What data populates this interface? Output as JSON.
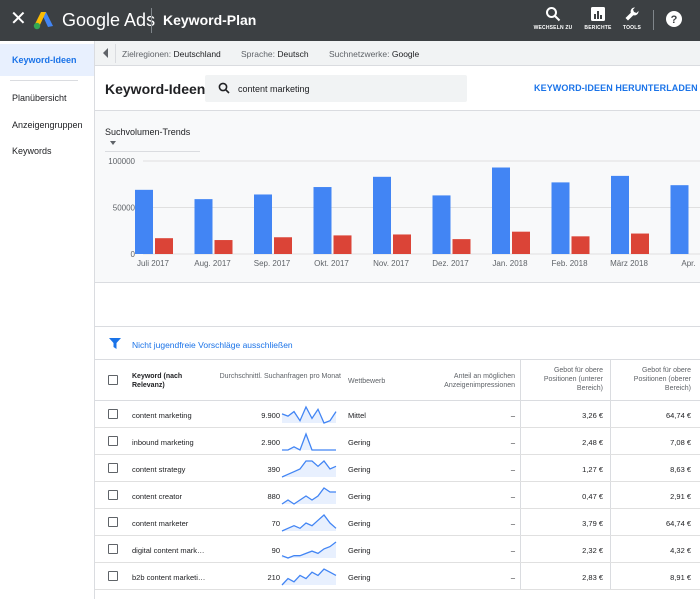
{
  "app": {
    "brand": "Google Ads",
    "page_title": "Keyword-Plan"
  },
  "toolbar": {
    "switch_label": "WECHSELN ZU",
    "reports_label": "BERICHTE",
    "tools_label": "TOOLS"
  },
  "sidebar": {
    "items": [
      {
        "label": "Keyword-Ideen",
        "active": true
      },
      {
        "label": "Planübersicht"
      },
      {
        "label": "Anzeigengruppen"
      },
      {
        "label": "Keywords"
      }
    ]
  },
  "filters": {
    "region_key": "Zielregionen:",
    "region_val": "Deutschland",
    "lang_key": "Sprache:",
    "lang_val": "Deutsch",
    "net_key": "Suchnetzwerke:",
    "net_val": "Google"
  },
  "header": {
    "title": "Keyword-Ideen",
    "search_value": "content marketing",
    "download": "KEYWORD-IDEEN HERUNTERLADEN"
  },
  "trend_select": "Suchvolumen-Trends",
  "chart_data": {
    "type": "bar",
    "categories": [
      "Juli 2017",
      "Aug. 2017",
      "Sep. 2017",
      "Okt. 2017",
      "Nov. 2017",
      "Dez. 2017",
      "Jan. 2018",
      "Feb. 2018",
      "März 2018",
      "Apr."
    ],
    "series": [
      {
        "values": [
          69000,
          59000,
          64000,
          72000,
          83000,
          63000,
          93000,
          77000,
          84000,
          74000
        ],
        "color": "#4285f4"
      },
      {
        "values": [
          17000,
          15000,
          18000,
          20000,
          21000,
          16000,
          24000,
          19000,
          22000,
          0
        ],
        "color": "#db4437"
      }
    ],
    "yticks": [
      "0",
      "50000",
      "100000"
    ],
    "ylim": [
      0,
      100000
    ]
  },
  "exclude_filter": "Nicht jugendfreie Vorschläge ausschließen",
  "table": {
    "headers": {
      "keyword": "Keyword (nach Relevanz)",
      "searches": "Durchschnittl. Suchanfragen pro Monat",
      "competition": "Wettbewerb",
      "share": "Anteil an möglichen Anzeigenimpressionen",
      "bid_low": "Gebot für obere Positionen (unterer Bereich)",
      "bid_high": "Gebot für obere Positionen (oberer Bereich)"
    },
    "rows": [
      {
        "keyword": "content marketing",
        "searches": "9.900",
        "competition": "Mittel",
        "share": "–",
        "bid_low": "3,26 €",
        "bid_high": "64,74 €",
        "spark": [
          5,
          4,
          6,
          2,
          8,
          3,
          7,
          1,
          2,
          6
        ]
      },
      {
        "keyword": "inbound marketing",
        "searches": "2.900",
        "competition": "Gering",
        "share": "–",
        "bid_low": "2,48 €",
        "bid_high": "7,08 €",
        "spark": [
          4,
          4,
          5,
          4,
          9,
          4,
          4,
          4,
          4,
          4
        ]
      },
      {
        "keyword": "content strategy",
        "searches": "390",
        "competition": "Gering",
        "share": "–",
        "bid_low": "1,27 €",
        "bid_high": "8,63 €",
        "spark": [
          2,
          3,
          4,
          5,
          8,
          8,
          6,
          8,
          5,
          6
        ]
      },
      {
        "keyword": "content creator",
        "searches": "880",
        "competition": "Gering",
        "share": "–",
        "bid_low": "0,47 €",
        "bid_high": "2,91 €",
        "spark": [
          3,
          4,
          3,
          4,
          5,
          4,
          5,
          7,
          6,
          6
        ]
      },
      {
        "keyword": "content marketer",
        "searches": "70",
        "competition": "Gering",
        "share": "–",
        "bid_low": "3,79 €",
        "bid_high": "64,74 €",
        "spark": [
          2,
          3,
          4,
          3,
          5,
          4,
          6,
          8,
          5,
          3
        ]
      },
      {
        "keyword": "digital content mark…",
        "searches": "90",
        "competition": "Gering",
        "share": "–",
        "bid_low": "2,32 €",
        "bid_high": "4,32 €",
        "spark": [
          2,
          1,
          2,
          2,
          3,
          4,
          3,
          5,
          6,
          8
        ]
      },
      {
        "keyword": "b2b content marketi…",
        "searches": "210",
        "competition": "Gering",
        "share": "–",
        "bid_low": "2,83 €",
        "bid_high": "8,91 €",
        "spark": [
          2,
          4,
          3,
          5,
          4,
          6,
          5,
          7,
          6,
          5
        ]
      }
    ]
  },
  "colors": {
    "accent": "#1a73e8",
    "topbar": "#3c4043",
    "bar_blue": "#4285f4",
    "bar_red": "#db4437",
    "sparkline": "#4285f4"
  },
  "icons": [
    "close-icon",
    "google-ads-logo-icon",
    "search-icon",
    "reports-icon",
    "wrench-icon",
    "help-icon",
    "filter-icon",
    "chevron-left-icon",
    "caret-down-icon"
  ]
}
